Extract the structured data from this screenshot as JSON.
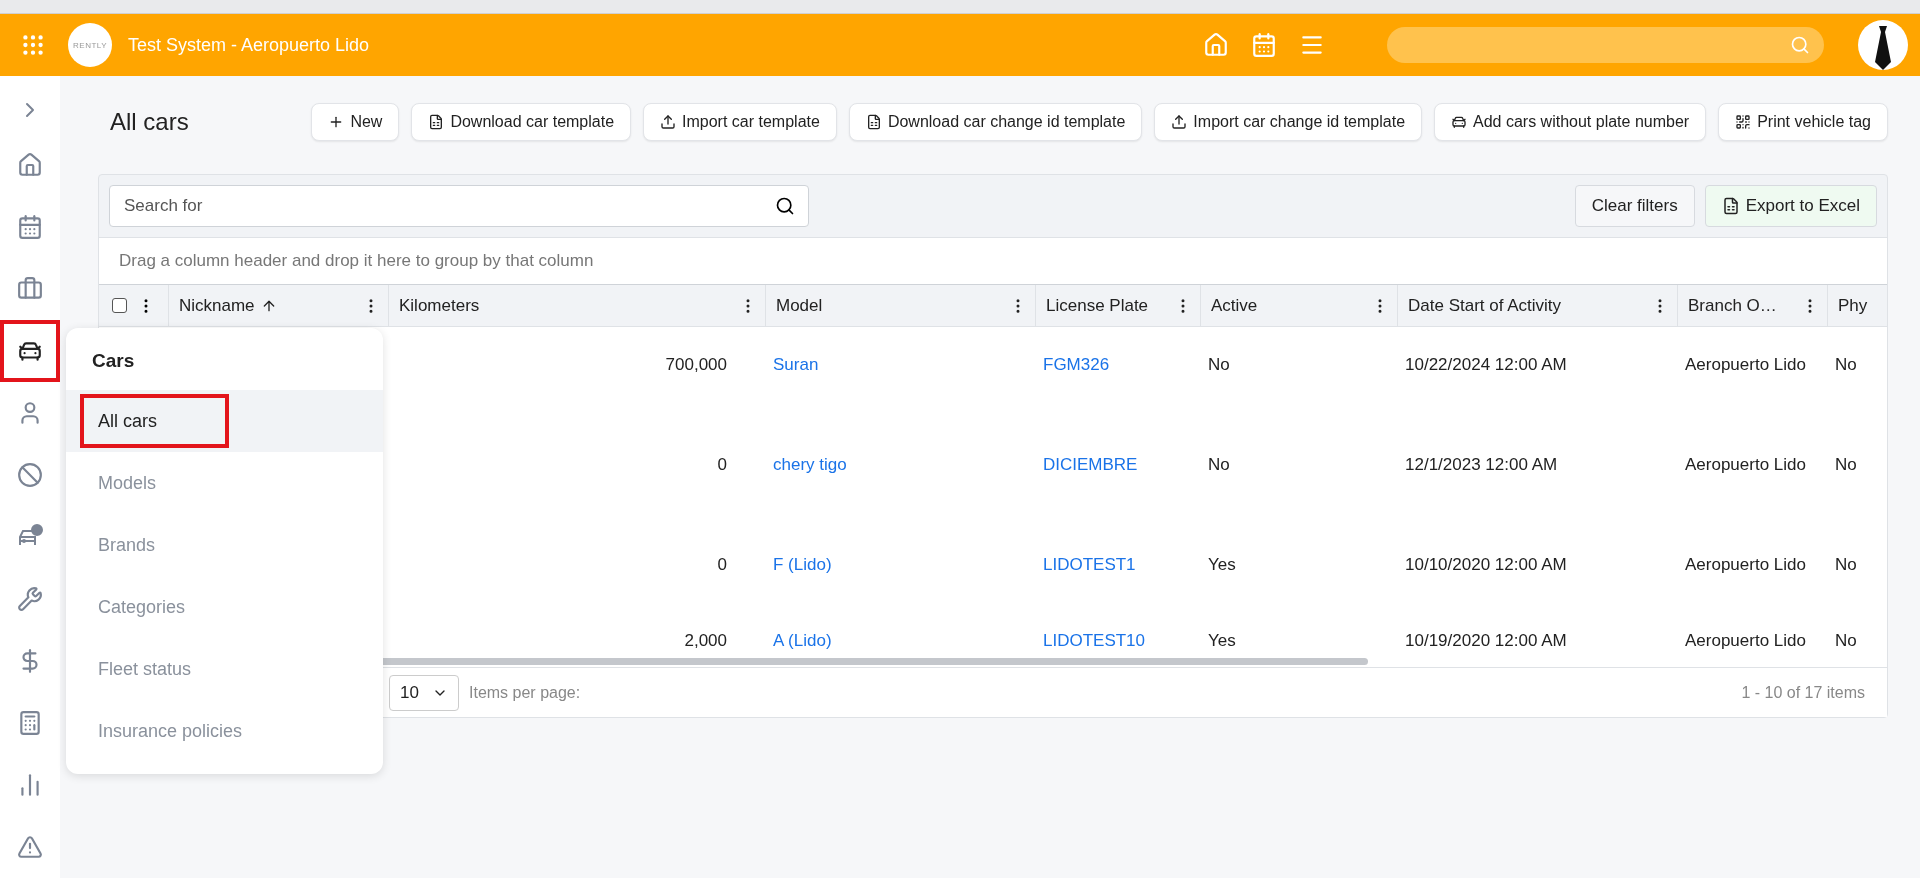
{
  "top_bar": {
    "logo_text": "RENTLY",
    "title": "Test System - Aeropuerto Lido"
  },
  "rail": {
    "items": [
      {
        "kind": "home",
        "highlighted": false
      },
      {
        "kind": "calendar",
        "highlighted": false
      },
      {
        "kind": "briefcase",
        "highlighted": false
      },
      {
        "kind": "car",
        "highlighted": true
      },
      {
        "kind": "user",
        "highlighted": false
      },
      {
        "kind": "ban",
        "highlighted": false
      },
      {
        "kind": "car-alert",
        "highlighted": false
      },
      {
        "kind": "wrench",
        "highlighted": false
      },
      {
        "kind": "dollar",
        "highlighted": false
      },
      {
        "kind": "calculator",
        "highlighted": false
      },
      {
        "kind": "chart",
        "highlighted": false
      },
      {
        "kind": "warning",
        "highlighted": false
      }
    ]
  },
  "flyout": {
    "title": "Cars",
    "items": [
      {
        "label": "All cars",
        "selected": true,
        "highlighted": true
      },
      {
        "label": "Models",
        "selected": false,
        "highlighted": false
      },
      {
        "label": "Brands",
        "selected": false,
        "highlighted": false
      },
      {
        "label": "Categories",
        "selected": false,
        "highlighted": false
      },
      {
        "label": "Fleet status",
        "selected": false,
        "highlighted": false
      },
      {
        "label": "Insurance policies",
        "selected": false,
        "highlighted": false
      }
    ]
  },
  "page": {
    "title": "All cars"
  },
  "toolbar": [
    {
      "label": "New"
    },
    {
      "label": "Download car template"
    },
    {
      "label": "Import car template"
    },
    {
      "label": "Download car change id template"
    },
    {
      "label": "Import car change id template"
    },
    {
      "label": "Add cars without plate number"
    },
    {
      "label": "Print vehicle tag"
    }
  ],
  "grid": {
    "select_all": {
      "checked": false
    },
    "search": {
      "placeholder": "Search for"
    },
    "clear_filters": "Clear filters",
    "export": "Export to Excel",
    "group_hint": "Drag a column header and drop it here to group by that column",
    "columns": [
      {
        "label": "Nickname",
        "sorted": true
      },
      {
        "label": "Kilometers",
        "sorted": false
      },
      {
        "label": "Model",
        "sorted": false
      },
      {
        "label": "License Plate",
        "sorted": false
      },
      {
        "label": "Active",
        "sorted": false
      },
      {
        "label": "Date Start of Activity",
        "sorted": false
      },
      {
        "label": "Branch O…",
        "sorted": false
      },
      {
        "label": "Phy",
        "sorted": false
      }
    ],
    "rows": [
      {
        "kilometers": "700,000",
        "model": "Suran",
        "plate": "FGM326",
        "active": "No",
        "date": "10/22/2024 12:00 AM",
        "branch": "Aeropuerto Lido",
        "column_8": "No"
      },
      {
        "kilometers": "0",
        "model": "chery tigo",
        "plate": "DICIEMBRE",
        "active": "No",
        "date": "12/1/2023 12:00 AM",
        "branch": "Aeropuerto Lido",
        "column_8": "No"
      },
      {
        "kilometers": "0",
        "model": "F (Lido)",
        "plate": "LIDOTEST1",
        "active": "Yes",
        "date": "10/10/2020 12:00 AM",
        "branch": "Aeropuerto Lido",
        "column_8": "No"
      },
      {
        "kilometers": "2,000",
        "model": "A (Lido)",
        "plate": "LIDOTEST10",
        "active": "Yes",
        "date": "10/19/2020 12:00 AM",
        "branch": "Aeropuerto Lido",
        "column_8": "No"
      }
    ],
    "pager": {
      "page_size": "10",
      "per_page_label": "Items per page:",
      "summary": "1 - 10 of 17 items"
    }
  }
}
